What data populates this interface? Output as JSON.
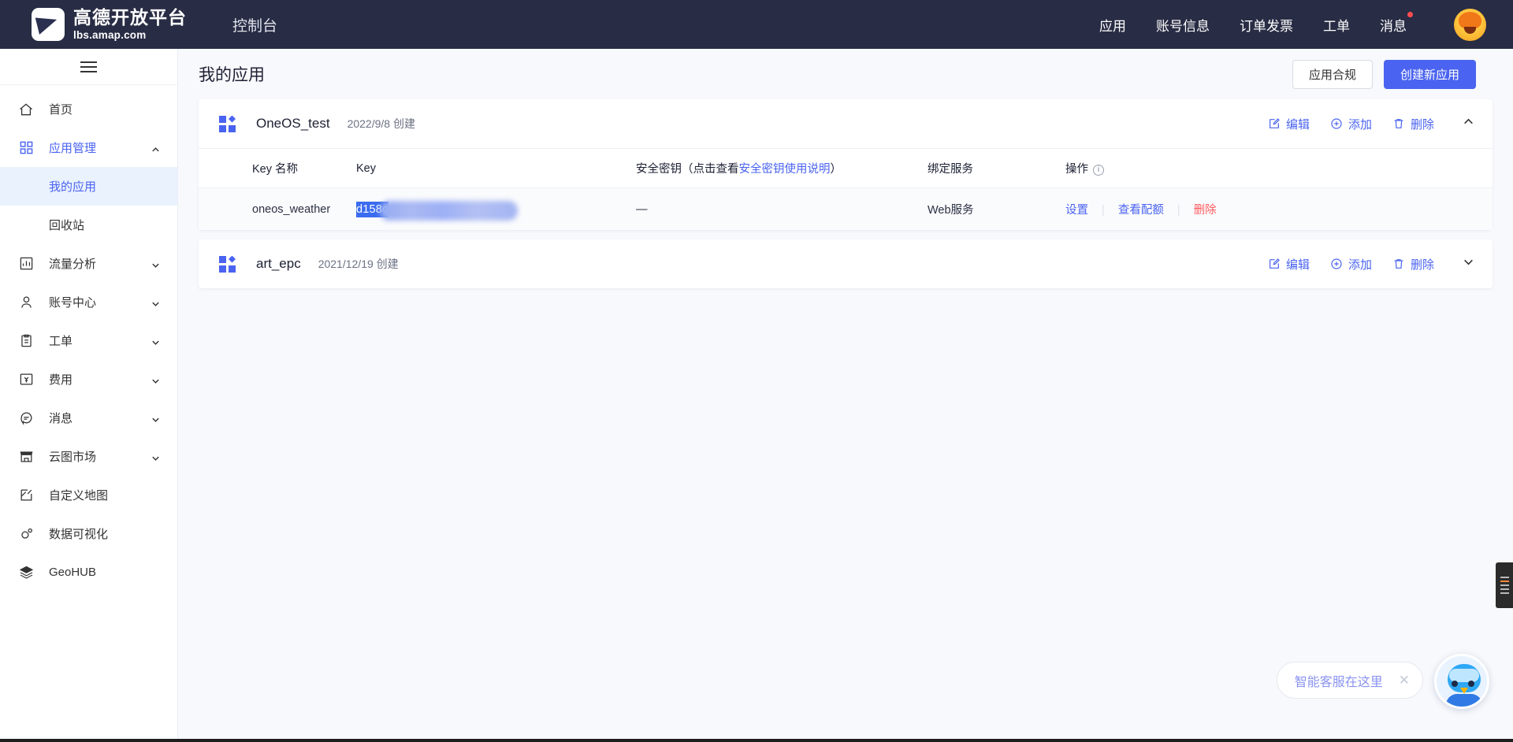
{
  "header": {
    "brand_cn": "高德开放平台",
    "brand_en": "lbs.amap.com",
    "console_label": "控制台",
    "nav": [
      {
        "label": "应用",
        "badge": false
      },
      {
        "label": "账号信息",
        "badge": false
      },
      {
        "label": "订单发票",
        "badge": false
      },
      {
        "label": "工单",
        "badge": false
      },
      {
        "label": "消息",
        "badge": true
      }
    ]
  },
  "sidebar": {
    "items": [
      {
        "label": "首页",
        "icon": "home-icon",
        "expandable": false,
        "accent": false
      },
      {
        "label": "应用管理",
        "icon": "apps-grid-icon",
        "expandable": true,
        "expanded": true,
        "accent": true
      },
      {
        "label": "流量分析",
        "icon": "chart-icon",
        "expandable": true,
        "expanded": false,
        "accent": false
      },
      {
        "label": "账号中心",
        "icon": "user-icon",
        "expandable": true,
        "expanded": false,
        "accent": false
      },
      {
        "label": "工单",
        "icon": "clipboard-icon",
        "expandable": true,
        "expanded": false,
        "accent": false
      },
      {
        "label": "费用",
        "icon": "yuan-icon",
        "expandable": true,
        "expanded": false,
        "accent": false
      },
      {
        "label": "消息",
        "icon": "message-icon",
        "expandable": true,
        "expanded": false,
        "accent": false
      },
      {
        "label": "云图市场",
        "icon": "store-icon",
        "expandable": true,
        "expanded": false,
        "accent": false
      },
      {
        "label": "自定义地图",
        "icon": "custom-map-icon",
        "expandable": false,
        "accent": false
      },
      {
        "label": "数据可视化",
        "icon": "data-viz-icon",
        "expandable": false,
        "accent": false
      },
      {
        "label": "GeoHUB",
        "icon": "layers-icon",
        "expandable": false,
        "accent": false
      }
    ],
    "sub_items": [
      {
        "label": "我的应用",
        "active": true
      },
      {
        "label": "回收站",
        "active": false
      }
    ]
  },
  "page": {
    "title": "我的应用",
    "compliance_button": "应用合规",
    "create_button": "创建新应用"
  },
  "table_headers": {
    "key_name": "Key 名称",
    "key": "Key",
    "secret_prefix": "安全密钥（点击查看",
    "secret_link": "安全密钥使用说明",
    "secret_suffix": "）",
    "bound_service": "绑定服务",
    "operation": "操作",
    "operation_info_icon": "ⓘ"
  },
  "card_actions": {
    "edit": "编辑",
    "add": "添加",
    "delete": "删除"
  },
  "apps": [
    {
      "name": "OneOS_test",
      "date_text": "2022/9/8 创建",
      "expanded": true,
      "rows": [
        {
          "key_name": "oneos_weather",
          "key_visible": "d158c",
          "key_redacted": true,
          "secret": "—",
          "bound_service": "Web服务",
          "actions": [
            "设置",
            "查看配额",
            "删除"
          ]
        }
      ]
    },
    {
      "name": "art_epc",
      "date_text": "2021/12/19 创建",
      "expanded": false,
      "rows": []
    }
  ],
  "chat": {
    "text": "智能客服在这里",
    "close_icon": "close-icon"
  },
  "colors": {
    "header_bg": "#282c44",
    "primary": "#4a63f0",
    "danger": "#ff5a5f",
    "page_bg": "#f8f9fc",
    "active_item_bg": "#eaf2fe"
  }
}
